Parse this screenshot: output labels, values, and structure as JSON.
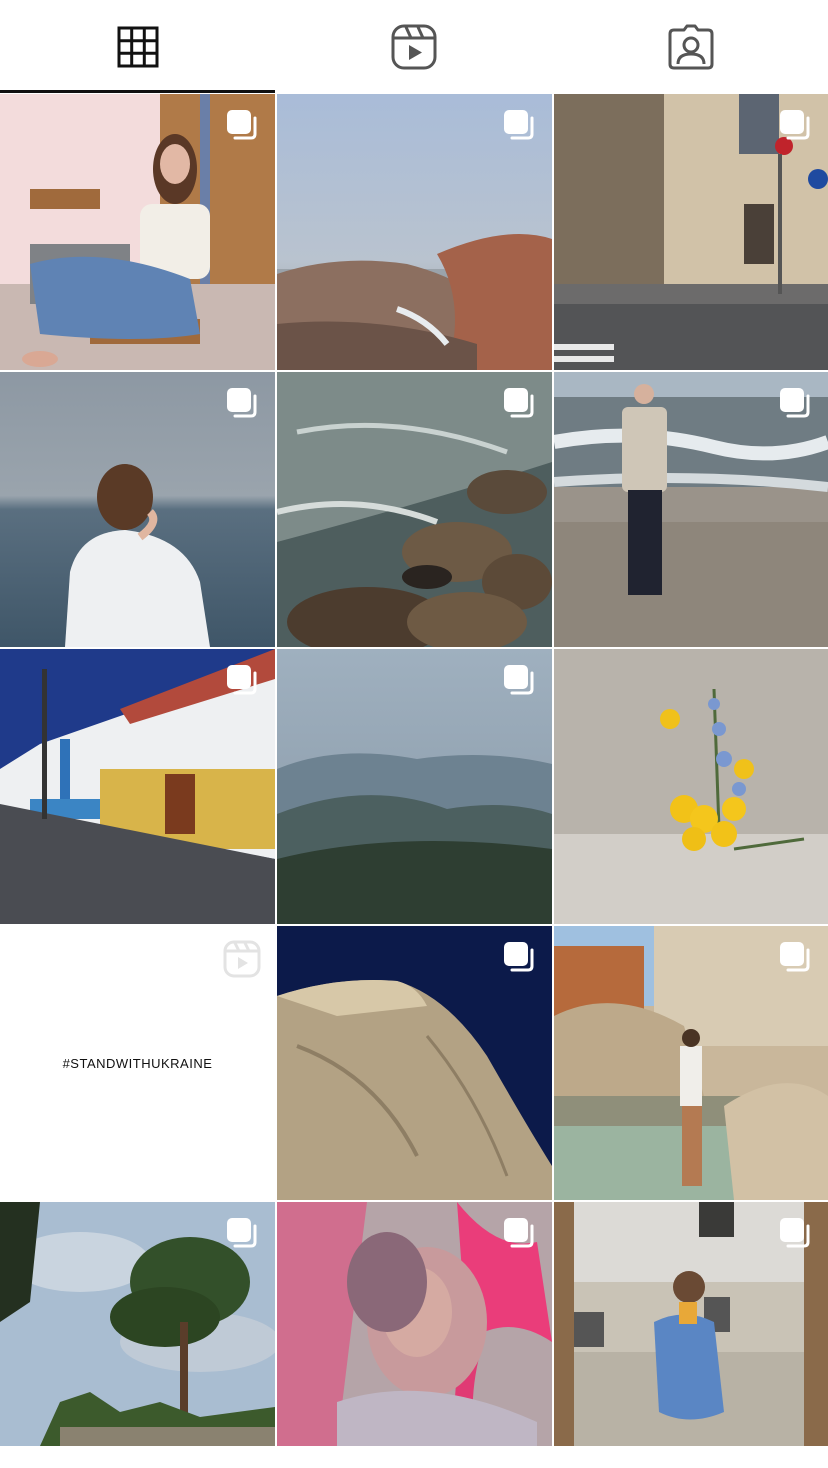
{
  "tabs": [
    {
      "name": "grid",
      "icon": "grid-icon",
      "active": true
    },
    {
      "name": "reels",
      "icon": "reels-icon",
      "active": false
    },
    {
      "name": "tagged",
      "icon": "tagged-icon",
      "active": false
    }
  ],
  "posts": [
    {
      "id": 1,
      "type": "carousel",
      "subject": "woman-in-chair"
    },
    {
      "id": 2,
      "type": "carousel",
      "subject": "misty-coast-rocks"
    },
    {
      "id": 3,
      "type": "carousel",
      "subject": "city-street-corner"
    },
    {
      "id": 4,
      "type": "carousel",
      "subject": "woman-by-sea"
    },
    {
      "id": 5,
      "type": "carousel",
      "subject": "rocky-shore-waves"
    },
    {
      "id": 6,
      "type": "carousel",
      "subject": "man-on-beach"
    },
    {
      "id": 7,
      "type": "carousel",
      "subject": "houses-on-street"
    },
    {
      "id": 8,
      "type": "carousel",
      "subject": "mountain-valley"
    },
    {
      "id": 9,
      "type": "carousel",
      "subject": "yellow-flowers"
    },
    {
      "id": 10,
      "type": "reel",
      "subject": "text-post",
      "caption": "#STANDWITHUKRAINE"
    },
    {
      "id": 11,
      "type": "carousel",
      "subject": "cliff-night-sky"
    },
    {
      "id": 12,
      "type": "carousel",
      "subject": "fountain-rocks"
    },
    {
      "id": 13,
      "type": "carousel",
      "subject": "pine-tree-sky"
    },
    {
      "id": 14,
      "type": "carousel",
      "subject": "blurred-portrait-pink"
    },
    {
      "id": 15,
      "type": "carousel",
      "subject": "mirror-selfie"
    }
  ]
}
